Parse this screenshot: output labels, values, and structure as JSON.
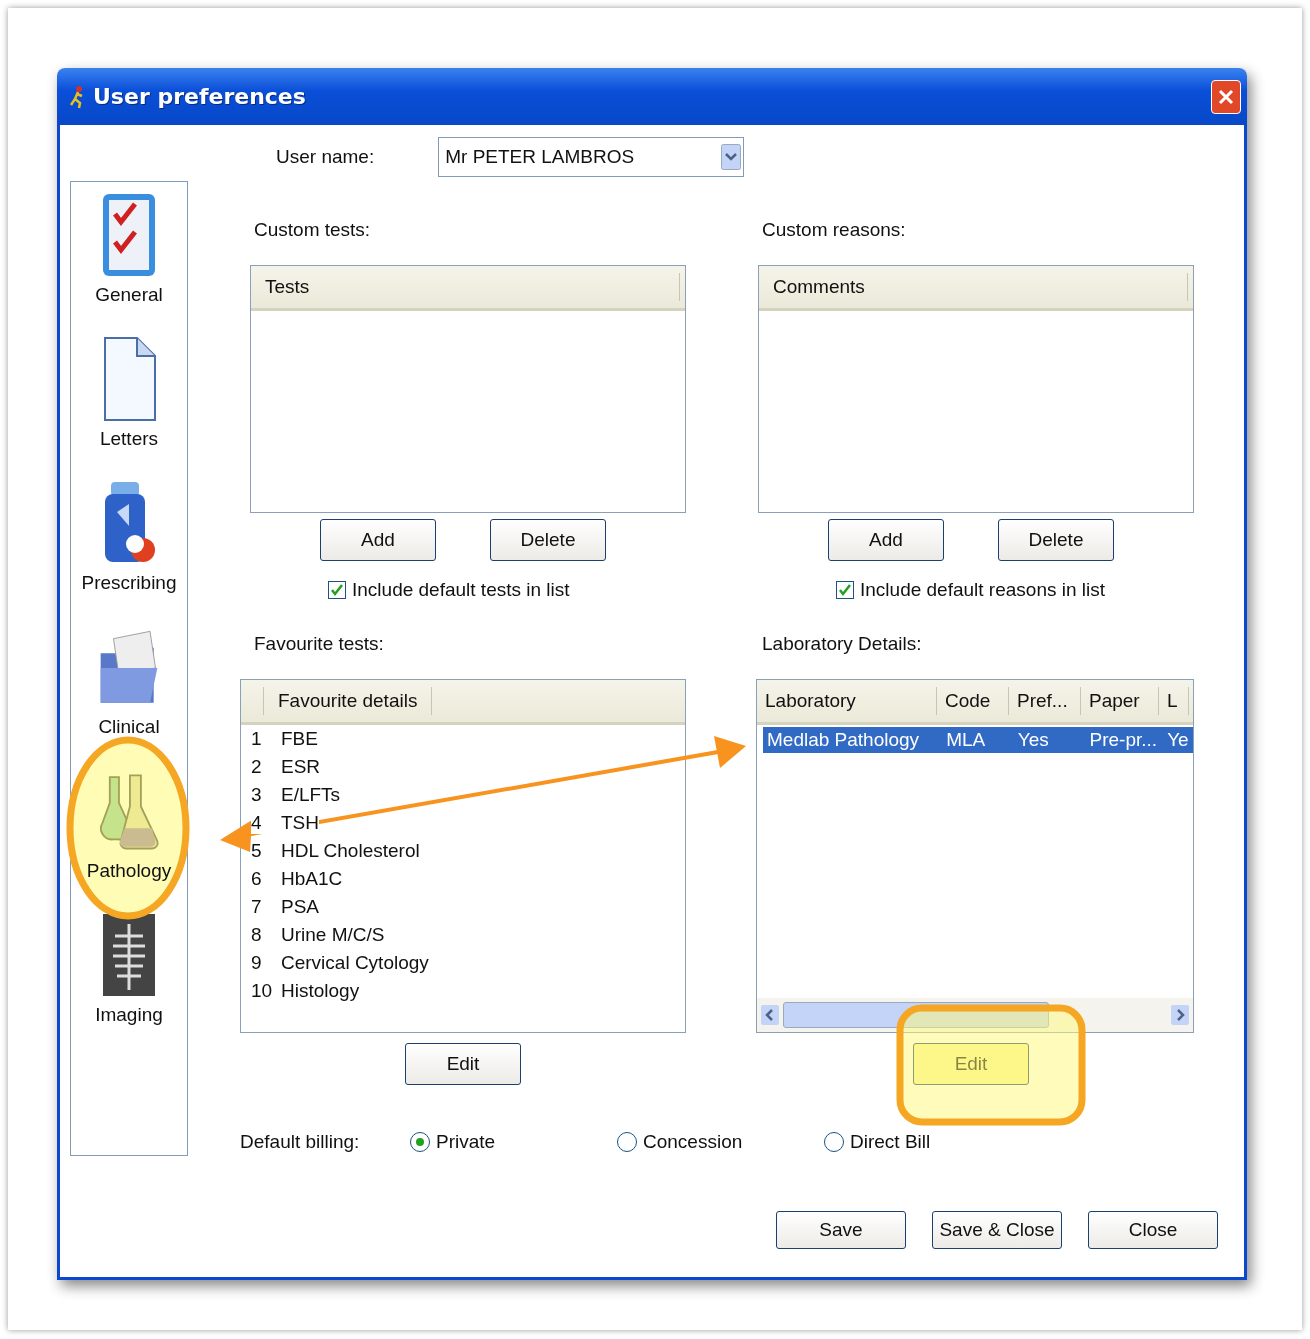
{
  "window": {
    "title": "User preferences"
  },
  "sidebar": {
    "items": [
      {
        "label": "General",
        "kind": "checklist"
      },
      {
        "label": "Letters",
        "kind": "document"
      },
      {
        "label": "Prescribing",
        "kind": "bottle"
      },
      {
        "label": "Clinical",
        "kind": "folder"
      },
      {
        "label": "Pathology",
        "kind": "flasks"
      },
      {
        "label": "Imaging",
        "kind": "xray"
      }
    ]
  },
  "user_name": {
    "label": "User name:",
    "value": "Mr PETER LAMBROS"
  },
  "custom_tests": {
    "label": "Custom tests:",
    "column": "Tests",
    "buttons": [
      "Add",
      "Delete"
    ],
    "include_default": {
      "label": "Include default tests in list",
      "checked": true
    }
  },
  "custom_reasons": {
    "label": "Custom reasons:",
    "column": "Comments",
    "buttons": [
      "Add",
      "Delete"
    ],
    "include_default": {
      "label": "Include default reasons in list",
      "checked": true
    }
  },
  "favourite_tests": {
    "label": "Favourite tests:",
    "column": "Favourite details",
    "rows": [
      {
        "number": "1",
        "name": "FBE"
      },
      {
        "number": "2",
        "name": "ESR"
      },
      {
        "number": "3",
        "name": "E/LFTs"
      },
      {
        "number": "4",
        "name": "TSH"
      },
      {
        "number": "5",
        "name": "HDL Cholesterol"
      },
      {
        "number": "6",
        "name": "HbA1C"
      },
      {
        "number": "7",
        "name": "PSA"
      },
      {
        "number": "8",
        "name": "Urine M/C/S"
      },
      {
        "number": "9",
        "name": "Cervical Cytology"
      },
      {
        "number": "10",
        "name": "Histology"
      }
    ],
    "button": "Edit"
  },
  "laboratory_details": {
    "label": "Laboratory Details:",
    "columns": [
      "Laboratory",
      "Code",
      "Pref...",
      "Paper",
      "L"
    ],
    "rows": [
      {
        "cells": [
          "Medlab Pathology",
          "MLA",
          "Yes",
          "Pre-pr...",
          "Ye"
        ],
        "selected": true
      }
    ],
    "button": "Edit"
  },
  "default_billing": {
    "label": "Default billing:",
    "options": [
      {
        "label": "Private",
        "selected": true
      },
      {
        "label": "Concession",
        "selected": false
      },
      {
        "label": "Direct Bill",
        "selected": false
      }
    ]
  },
  "footer_buttons": [
    "Save",
    "Save & Close",
    "Close"
  ]
}
